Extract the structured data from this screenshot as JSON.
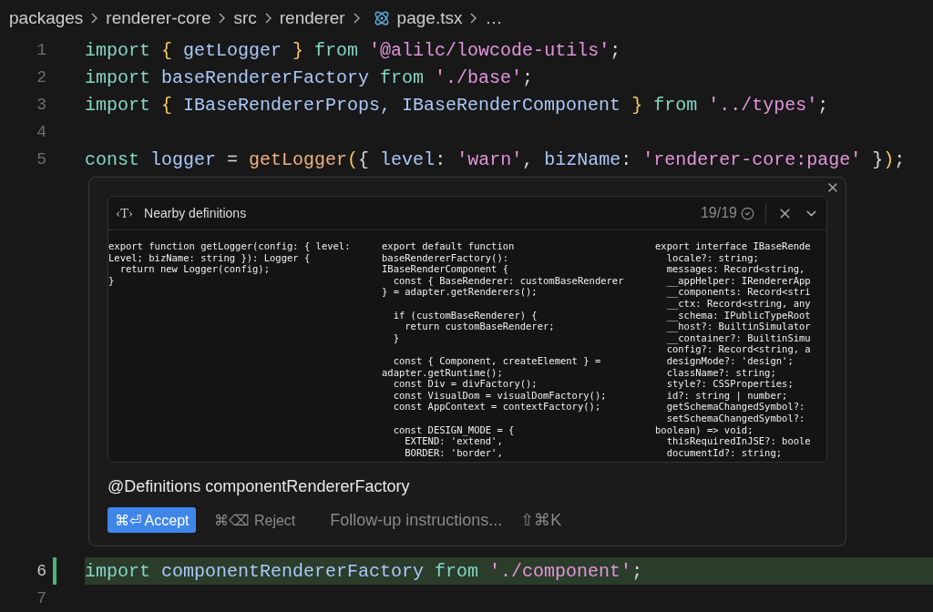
{
  "breadcrumb": [
    {
      "label": "packages",
      "kind": "folder"
    },
    {
      "label": "renderer-core",
      "kind": "folder"
    },
    {
      "label": "src",
      "kind": "folder"
    },
    {
      "label": "renderer",
      "kind": "folder"
    },
    {
      "label": "page.tsx",
      "kind": "file"
    },
    {
      "label": "…",
      "kind": "more"
    }
  ],
  "code_lines_top": [
    {
      "number": "1",
      "highlighted": false,
      "tokens": [
        {
          "text": "import ",
          "kind": "keyword"
        },
        {
          "text": "{ ",
          "kind": "brace"
        },
        {
          "text": "getLogger ",
          "kind": "ident"
        },
        {
          "text": "} ",
          "kind": "brace"
        },
        {
          "text": "from ",
          "kind": "keyword"
        },
        {
          "text": "'@alilc/lowcode-utils'",
          "kind": "string"
        },
        {
          "text": ";",
          "kind": "plain"
        }
      ]
    },
    {
      "number": "2",
      "highlighted": false,
      "tokens": [
        {
          "text": "import ",
          "kind": "keyword"
        },
        {
          "text": "baseRendererFactory ",
          "kind": "ident"
        },
        {
          "text": "from ",
          "kind": "keyword"
        },
        {
          "text": "'./base'",
          "kind": "string"
        },
        {
          "text": ";",
          "kind": "plain"
        }
      ]
    },
    {
      "number": "3",
      "highlighted": false,
      "tokens": [
        {
          "text": "import ",
          "kind": "keyword"
        },
        {
          "text": "{ ",
          "kind": "brace"
        },
        {
          "text": "IBaseRendererProps, IBaseRenderComponent ",
          "kind": "ident"
        },
        {
          "text": "} ",
          "kind": "brace"
        },
        {
          "text": "from ",
          "kind": "keyword"
        },
        {
          "text": "'../types'",
          "kind": "string"
        },
        {
          "text": ";",
          "kind": "plain"
        }
      ]
    },
    {
      "number": "4",
      "highlighted": false
    },
    {
      "number": "5",
      "highlighted": false,
      "tokens": [
        {
          "text": "const ",
          "kind": "keyword"
        },
        {
          "text": "logger ",
          "kind": "ident"
        },
        {
          "text": "= ",
          "kind": "plain"
        },
        {
          "text": "getLogger",
          "kind": "func"
        },
        {
          "text": "(",
          "kind": "brace"
        },
        {
          "text": "{ ",
          "kind": "brace2"
        },
        {
          "text": "level",
          "kind": "ident"
        },
        {
          "text": ": ",
          "kind": "plain"
        },
        {
          "text": "'warn'",
          "kind": "string"
        },
        {
          "text": ", ",
          "kind": "plain"
        },
        {
          "text": "bizName",
          "kind": "ident"
        },
        {
          "text": ": ",
          "kind": "plain"
        },
        {
          "text": "'renderer-core:page' ",
          "kind": "string"
        },
        {
          "text": "}",
          "kind": "brace2"
        },
        {
          "text": ")",
          "kind": "brace"
        },
        {
          "text": ";",
          "kind": "plain"
        }
      ]
    }
  ],
  "definitions_widget": {
    "type_icon": "‹T›",
    "title": "Nearby definitions",
    "count": "19/19",
    "columns": [
      [
        "export function getLogger(config: { level:",
        "Level; bizName: string }): Logger {",
        "  return new Logger(config);",
        "}"
      ],
      [
        "export default function",
        "baseRendererFactory():",
        "IBaseRenderComponent {",
        "  const { BaseRenderer: customBaseRenderer",
        "} = adapter.getRenderers();",
        "",
        "  if (customBaseRenderer) {",
        "    return customBaseRenderer;",
        "  }",
        "",
        "  const { Component, createElement } =",
        "adapter.getRuntime();",
        "  const Div = divFactory();",
        "  const VisualDom = visualDomFactory();",
        "  const AppContext = contextFactory();",
        "",
        "  const DESIGN_MODE = {",
        "    EXTEND: 'extend',",
        "    BORDER: 'border',"
      ],
      [
        "export interface IBaseRende",
        "  locale?: string;",
        "  messages: Record<string,",
        "  __appHelper: IRendererApp",
        "  __components: Record<stri",
        "  __ctx: Record<string, any",
        "  __schema: IPublicTypeRoot",
        "  __host?: BuiltinSimulator",
        "  __container?: BuiltinSimu",
        "  config?: Record<string, a",
        "  designMode?: 'design';",
        "  className?: string;",
        "  style?: CSSProperties;",
        "  id?: string | number;",
        "  getSchemaChangedSymbol?:",
        "  setSchemaChangedSymbol?:",
        "boolean) => void;",
        "  thisRequiredInJSE?: boole",
        "  documentId?: string;"
      ]
    ],
    "context": "@Definitions componentRendererFactory",
    "accept": {
      "shortcut": "⌘⏎",
      "label": "Accept"
    },
    "reject": {
      "shortcut": "⌘⌫",
      "label": "Reject"
    },
    "followup": {
      "placeholder": "Follow-up instructions...",
      "shortcut": "⇧⌘K"
    }
  },
  "code_lines_bottom": [
    {
      "number": "6",
      "highlighted": true,
      "tokens": [
        {
          "text": "import ",
          "kind": "keyword"
        },
        {
          "text": "componentRendererFactory ",
          "kind": "ident"
        },
        {
          "text": "from ",
          "kind": "keyword"
        },
        {
          "text": "'./component'",
          "kind": "string"
        },
        {
          "text": ";",
          "kind": "plain"
        }
      ]
    },
    {
      "number": "7",
      "highlighted": false
    }
  ]
}
